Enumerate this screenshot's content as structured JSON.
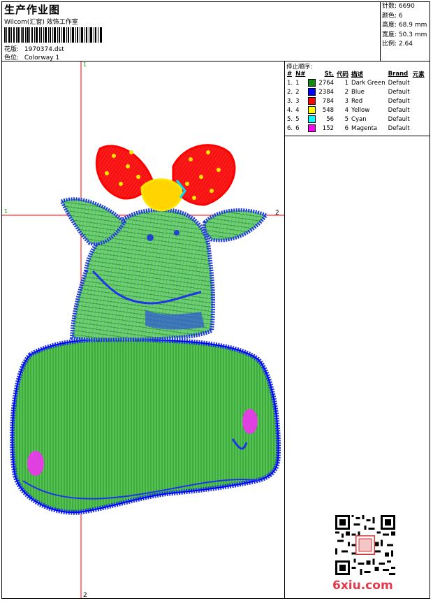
{
  "header": {
    "title": "生产作业图",
    "subtitle": "Wilcom(汇窗) 效饰工作室",
    "design_label": "花版:",
    "design_value": "1970374.dst",
    "colorway_label": "色位:",
    "colorway_value": "Colorway 1"
  },
  "stats": [
    {
      "label": "针数:",
      "value": "6690"
    },
    {
      "label": "颜色:",
      "value": "6"
    },
    {
      "label": "高度:",
      "value": "68.9 mm"
    },
    {
      "label": "宽度:",
      "value": "50.3 mm"
    },
    {
      "label": "比例:",
      "value": "2.64"
    }
  ],
  "stop_panel": {
    "title": "停止顺序:",
    "headers": [
      "#",
      "N#",
      "St.",
      "代码",
      "描述",
      "Brand",
      "元素"
    ],
    "rows": [
      {
        "idx": "1.",
        "n": "1",
        "color": "#118c11",
        "st": "2764",
        "code": "1",
        "desc": "Dark Green",
        "brand": "Default"
      },
      {
        "idx": "2.",
        "n": "2",
        "color": "#0000ff",
        "st": "2384",
        "code": "2",
        "desc": "Blue",
        "brand": "Default"
      },
      {
        "idx": "3.",
        "n": "3",
        "color": "#ff0000",
        "st": "784",
        "code": "3",
        "desc": "Red",
        "brand": "Default"
      },
      {
        "idx": "4.",
        "n": "4",
        "color": "#ffff00",
        "st": "548",
        "code": "4",
        "desc": "Yellow",
        "brand": "Default"
      },
      {
        "idx": "5.",
        "n": "5",
        "color": "#00ffff",
        "st": "56",
        "code": "5",
        "desc": "Cyan",
        "brand": "Default"
      },
      {
        "idx": "6.",
        "n": "6",
        "color": "#ff00ff",
        "st": "152",
        "code": "6",
        "desc": "Magenta",
        "brand": "Default"
      }
    ]
  },
  "canvas": {
    "crosshair_color": "#ff0000",
    "markers": {
      "top": "1",
      "left": "1",
      "right": "2",
      "bottom": "2"
    }
  },
  "watermark": {
    "site": "6xiu.com"
  }
}
